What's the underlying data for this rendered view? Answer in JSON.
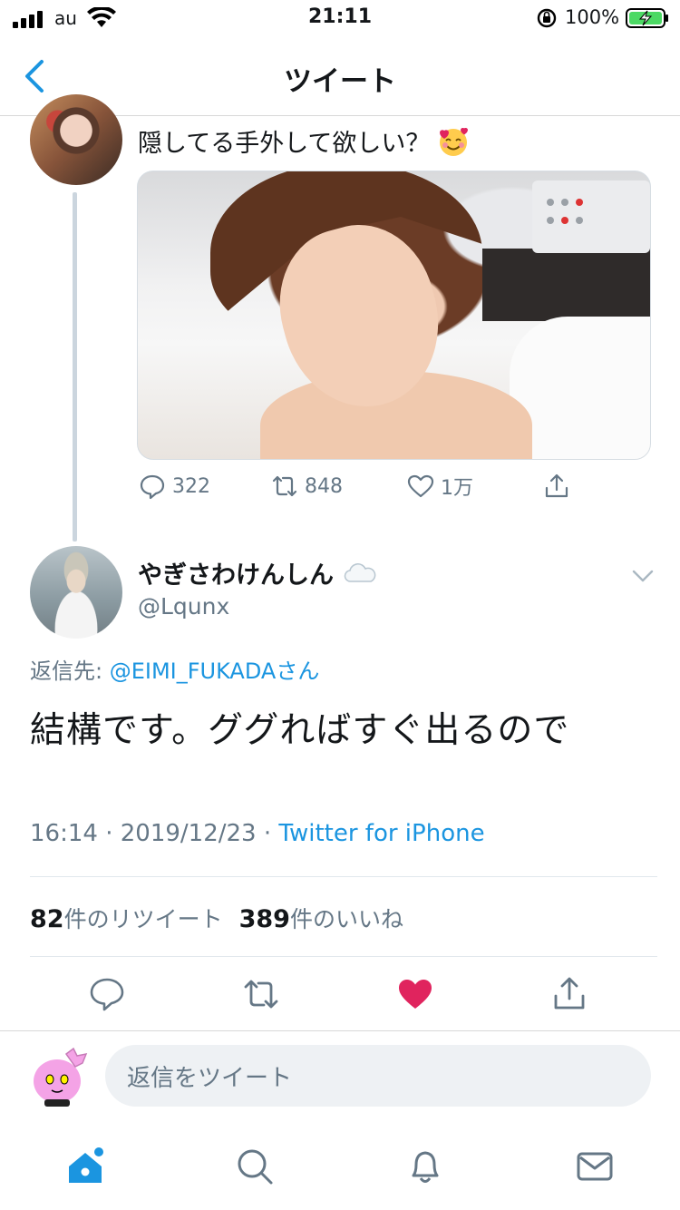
{
  "status_bar": {
    "carrier": "au",
    "time": "21:11",
    "battery_percent": "100%"
  },
  "header": {
    "title": "ツイート",
    "back_icon": "chevron-left-icon"
  },
  "parent_tweet": {
    "text": "隠してる手外して欲しい？",
    "emoji": "smiling-face-with-hearts",
    "actions": {
      "replies": "322",
      "retweets": "848",
      "likes": "1万"
    }
  },
  "tweet": {
    "display_name": "やぎさわけんしん",
    "handle": "@Lqunx",
    "reply_to_prefix": "返信先: ",
    "reply_to_mention": "@EIMI_FUKADAさん",
    "body": "結構です。ググればすぐ出るので",
    "time": "16:14",
    "date": "2019/12/23",
    "source": "Twitter for iPhone",
    "retweet_count": "82",
    "retweet_label": "件のリツイート",
    "like_count": "389",
    "like_label": "件のいいね",
    "liked": true
  },
  "composer": {
    "placeholder": "返信をツイート"
  },
  "tabbar": {
    "items": [
      "home-icon",
      "search-icon",
      "notifications-icon",
      "messages-icon"
    ]
  },
  "colors": {
    "accent": "#1b95e0",
    "like": "#e0245e",
    "muted": "#657786"
  }
}
